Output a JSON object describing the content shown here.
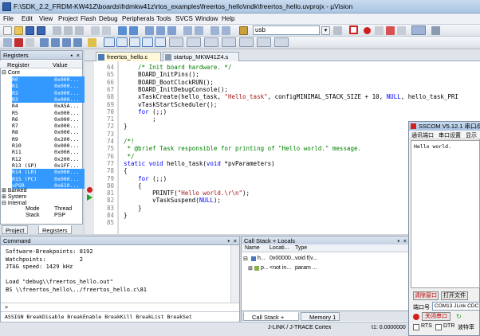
{
  "window": {
    "title": "F:\\SDK_2.2_FRDM-KW41Z\\boards\\frdmkw41z\\rtos_examples\\freertos_hello\\mdk\\freertos_hello.uvprojx - µVision"
  },
  "menu": [
    "File",
    "Edit",
    "View",
    "Project",
    "Flash",
    "Debug",
    "Peripherals",
    "Tools",
    "SVCS",
    "Window",
    "Help"
  ],
  "toolbar": {
    "target": "usb"
  },
  "registers": {
    "title": "Registers",
    "col_register": "Register",
    "col_value": "Value",
    "core": "Core",
    "rows": [
      {
        "name": "R0",
        "value": "0x000...",
        "sel": true
      },
      {
        "name": "R1",
        "value": "0x000...",
        "sel": true
      },
      {
        "name": "R2",
        "value": "0x000...",
        "sel": true
      },
      {
        "name": "R3",
        "value": "0x000...",
        "sel": true
      },
      {
        "name": "R4",
        "value": "0xA5A...",
        "sel": false
      },
      {
        "name": "R5",
        "value": "0x000...",
        "sel": false
      },
      {
        "name": "R6",
        "value": "0x000...",
        "sel": false
      },
      {
        "name": "R7",
        "value": "0x000...",
        "sel": false
      },
      {
        "name": "R8",
        "value": "0x000...",
        "sel": false
      },
      {
        "name": "R9",
        "value": "0x200...",
        "sel": false
      },
      {
        "name": "R10",
        "value": "0x000...",
        "sel": false
      },
      {
        "name": "R11",
        "value": "0x000...",
        "sel": false
      },
      {
        "name": "R12",
        "value": "0x200...",
        "sel": false
      },
      {
        "name": "R13 (SP)",
        "value": "0x1FF...",
        "sel": false
      },
      {
        "name": "R14 (LR)",
        "value": "0x000...",
        "sel": true
      },
      {
        "name": "R15 (PC)",
        "value": "0x000...",
        "sel": true
      },
      {
        "name": "xPSR",
        "value": "0x610...",
        "sel": true
      }
    ],
    "banked": "Banked",
    "system": "System",
    "internal": "Internal",
    "mode_label": "Mode",
    "mode_value": "Thread",
    "stack_label": "Stack",
    "stack_value": "PSP",
    "tab_project": "Project",
    "tab_registers": "Registers"
  },
  "editor": {
    "tab_active": "freertos_hello.c",
    "tab_other": "startup_MKW41Z4.s",
    "lines": [
      {
        "n": "64",
        "code": "    /* Init board hardware. */"
      },
      {
        "n": "65",
        "code": "    BOARD_InitPins();"
      },
      {
        "n": "66",
        "code": "    BOARD_BootClockRUN();"
      },
      {
        "n": "67",
        "code": "    BOARD_InitDebugConsole();"
      },
      {
        "n": "68",
        "code": "    xTaskCreate(hello_task, \"Hello_task\", configMINIMAL_STACK_SIZE + 10, NULL, hello_task_PRI"
      },
      {
        "n": "69",
        "code": "    vTaskStartScheduler();"
      },
      {
        "n": "70",
        "code": "    for (;;)"
      },
      {
        "n": "71",
        "code": "        ;"
      },
      {
        "n": "72",
        "code": "}"
      },
      {
        "n": "73",
        "code": ""
      },
      {
        "n": "74",
        "code": "/*!"
      },
      {
        "n": "75",
        "code": " * @brief Task responsible for printing of \"Hello world.\" message."
      },
      {
        "n": "76",
        "code": " */"
      },
      {
        "n": "77",
        "code": "static void hello_task(void *pvParameters)"
      },
      {
        "n": "78",
        "code": "{"
      },
      {
        "n": "79",
        "code": "    for (;;)"
      },
      {
        "n": "80",
        "code": "    {"
      },
      {
        "n": "81",
        "code": "        PRINTF(\"Hello world.\\r\\n\");"
      },
      {
        "n": "82",
        "code": "        vTaskSuspend(NULL);"
      },
      {
        "n": "83",
        "code": "    }"
      },
      {
        "n": "84",
        "code": "}"
      },
      {
        "n": "85",
        "code": ""
      }
    ]
  },
  "command": {
    "title": "Command",
    "lines": [
      "Software-Breakpoints: 8192",
      "Watchpoints:          2",
      "JTAG speed: 1429 kHz",
      "",
      "Load \"debug\\\\freertos_hello.out\"",
      "BS \\\\freertos_hello\\../freertos_hello.c\\81"
    ],
    "prompt": ">",
    "hint": "ASSIGN BreakDisable BreakEnable BreakKill BreakList BreakSet"
  },
  "callstack": {
    "title": "Call Stack + Locals",
    "col_name": "Name",
    "col_location": "Locati...",
    "col_type": "Type",
    "rows": [
      {
        "name": "h...",
        "location": "0x00000...",
        "type": "void f(v..."
      },
      {
        "name": "p...",
        "location": "<not in...",
        "type": "param ..."
      }
    ],
    "tab_callstack": "Call Stack + Locals",
    "tab_memory": "Memory 1"
  },
  "status": {
    "debugger": "J-LINK / J-TRACE Cortex",
    "time": "t1: 0.0000000"
  },
  "sscom": {
    "title": "SSCOM V5.12.1 串口/网络",
    "menu1": "通讯端口",
    "menu2": "串口设置",
    "menu3": "显示",
    "received": "Hello world.",
    "clear_btn": "清除窗口",
    "open_file_btn": "打开文件",
    "port_label": "端口号",
    "port_value": "COM13 JLink CDC U",
    "close_port_btn": "关闭串口",
    "rts": "RTS",
    "dtr": "DTR",
    "baud": "波特率"
  }
}
